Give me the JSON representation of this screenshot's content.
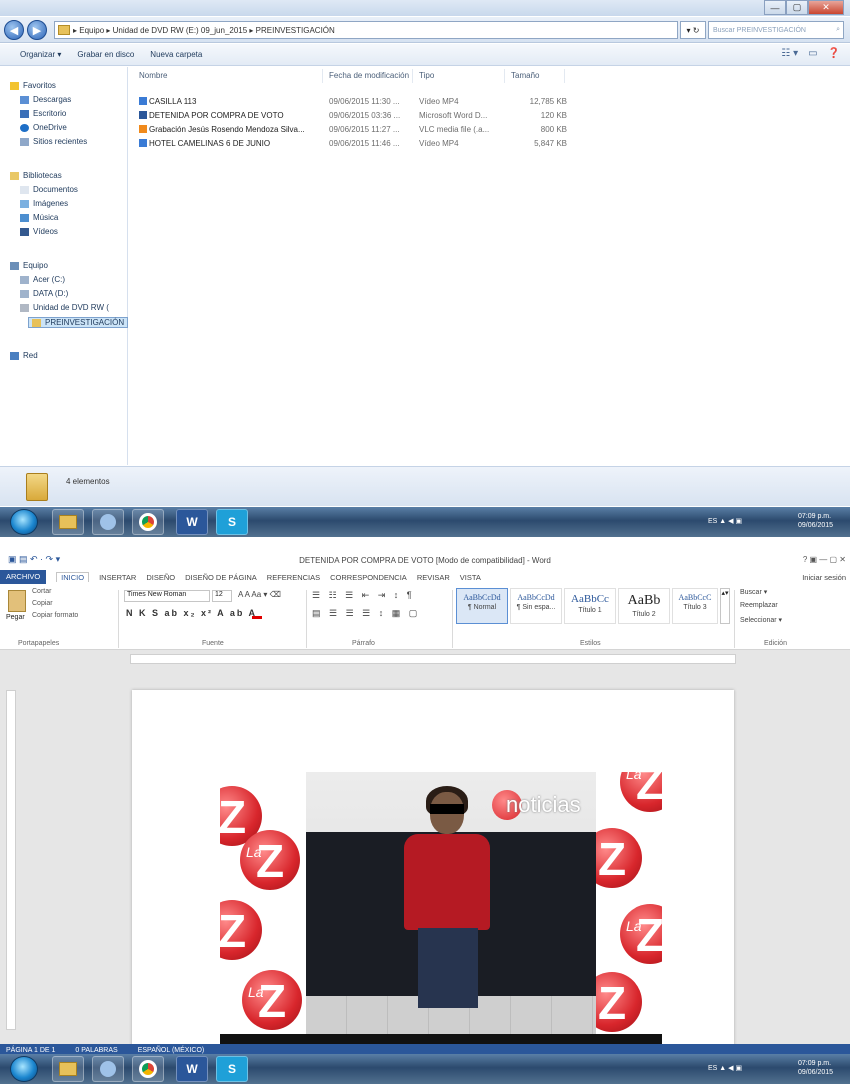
{
  "explorer": {
    "address_path": "▸ Equipo ▸ Unidad de DVD RW (E:) 09_jun_2015 ▸ PREINVESTIGACIÓN",
    "search_placeholder": "Buscar PREINVESTIGACIÓN",
    "window_controls": {
      "minimize": "—",
      "maximize": "▢",
      "close": "✕"
    },
    "command_bar": {
      "organize": "Organizar ▾",
      "burn": "Grabar en disco",
      "new_folder": "Nueva carpeta"
    },
    "nav": {
      "favorites": "Favoritos",
      "downloads": "Descargas",
      "desktop": "Escritorio",
      "onedrive": "OneDrive",
      "recent": "Sitios recientes",
      "libraries": "Bibliotecas",
      "documents": "Documentos",
      "images": "Imágenes",
      "music": "Música",
      "videos": "Vídeos",
      "computer": "Equipo",
      "acer_c": "Acer (C:)",
      "data_d": "DATA (D:)",
      "dvd": "Unidad de DVD RW (",
      "preinv": "PREINVESTIGACIÓN",
      "network": "Red"
    },
    "columns": {
      "name": "Nombre",
      "modified": "Fecha de modificación",
      "type": "Tipo",
      "size": "Tamaño"
    },
    "files": [
      {
        "name": "CASILLA 113",
        "date": "09/06/2015 11:30 ...",
        "type": "Vídeo MP4",
        "size": "12,785 KB"
      },
      {
        "name": "DETENIDA POR COMPRA DE VOTO",
        "date": "09/06/2015 03:36 ...",
        "type": "Microsoft Word D...",
        "size": "120 KB"
      },
      {
        "name": "Grabación Jesús Rosendo Mendoza Silva...",
        "date": "09/06/2015 11:27 ...",
        "type": "VLC media file (.a...",
        "size": "800 KB"
      },
      {
        "name": "HOTEL CAMELINAS 6 DE JUNIO",
        "date": "09/06/2015 11:46 ...",
        "type": "Vídeo MP4",
        "size": "5,847 KB"
      }
    ],
    "details": "4 elementos"
  },
  "taskbar_top": {
    "word_label": "W",
    "s_label": "S",
    "tray_text": "ES ▲ ◀ ▣",
    "clock": "07:09 p.m.\n09/06/2015"
  },
  "word": {
    "title": "DETENIDA POR COMPRA DE VOTO [Modo de compatibilidad] - Word",
    "title_controls": "? ▣ — ▢ ✕",
    "tabs": [
      "ARCHIVO",
      "INICIO",
      "INSERTAR",
      "DISEÑO",
      "DISEÑO DE PÁGINA",
      "REFERENCIAS",
      "CORRESPONDENCIA",
      "REVISAR",
      "VISTA"
    ],
    "user": "Iniciar sesión",
    "clipboard": {
      "paste": "Pegar",
      "cut": "Cortar",
      "copy": "Copiar",
      "format": "Copiar formato",
      "label": "Portapapeles"
    },
    "font": {
      "name": "Times New Roman",
      "size": "12",
      "label": "Fuente"
    },
    "paragraph_label": "Párrafo",
    "styles": [
      {
        "sample": "AaBbCcDd",
        "name": "¶ Normal"
      },
      {
        "sample": "AaBbCcDd",
        "name": "¶ Sin espa..."
      },
      {
        "sample": "AaBbCc",
        "name": "Título 1"
      },
      {
        "sample": "AaBb",
        "name": "Título 2"
      },
      {
        "sample": "AaBbCcC",
        "name": "Título 3"
      }
    ],
    "styles_label": "Estilos",
    "edit": {
      "find": "Buscar ▾",
      "replace": "Reemplazar",
      "select": "Seleccionar ▾",
      "label": "Edición"
    },
    "status": {
      "page": "PÁGINA 1 DE 1",
      "words": "0 PALABRAS",
      "lang": "ESPAÑOL (MÉXICO)"
    },
    "image_brand": "noticias",
    "image_la": "La"
  },
  "taskbar_bottom": {
    "clock": "07:09 p.m.\n09/06/2015"
  }
}
